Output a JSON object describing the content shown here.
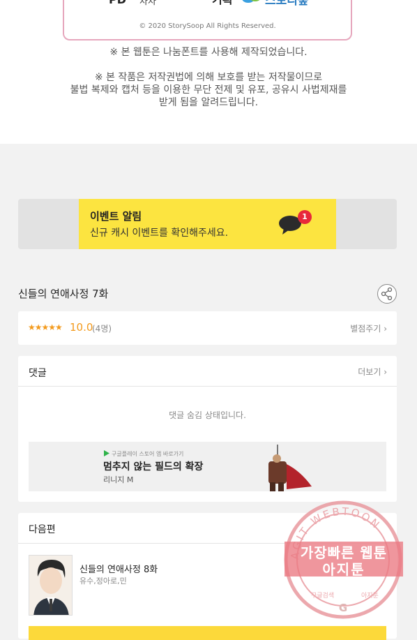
{
  "credits": {
    "pd_label": "PD",
    "pd_name": "차차",
    "plan_label": "기획",
    "studio_name": "스토리숲",
    "copyright": "© 2020 StorySoop All Rights Reserved."
  },
  "notices": {
    "font_notice": "※ 본 웹툰은 나눔폰트를 사용해 제작되었습니다.",
    "copyright_line1": "※ 본 작품은 저작권법에 의해 보호를 받는 저작물이므로",
    "copyright_line2": "불법 복제와 캡처 등을 이용한 무단 전제 및 유포, 공유시 사법제재를",
    "copyright_line3": "받게 됨을 알려드립니다."
  },
  "event": {
    "title": "이벤트 알림",
    "subtitle": "신규 캐시 이벤트를 확인해주세요.",
    "badge_count": "1",
    "background_color": "#fce440",
    "icon": "chat-bubble-icon"
  },
  "episode": {
    "title": "신들의 연애사정 7화",
    "share_icon": "share-icon"
  },
  "rating": {
    "stars": "★★★★★",
    "score": "10.0",
    "count": "(4명)",
    "rate_button": "별점주기 ›",
    "star_color": "#f39a1c"
  },
  "comments": {
    "title": "댓글",
    "more": "더보기 ›",
    "hidden_message": "댓글 숨김 상태입니다."
  },
  "ad": {
    "store_text": "구글플레이 스토어 앱 바로가기",
    "title": "멈추지 않는 필드의 확장",
    "subtitle": "리니지 M"
  },
  "next_episode": {
    "section_title": "다음편",
    "title": "신들의 연애사정 8화",
    "authors": "유수,정아로,민"
  },
  "watermark": {
    "ring_text": "AGIT WEBTOON",
    "line1": "가장빠른 웹툰",
    "line2": "아지툰",
    "bottom_left": "구글검색",
    "bottom_right": "아지툰"
  }
}
